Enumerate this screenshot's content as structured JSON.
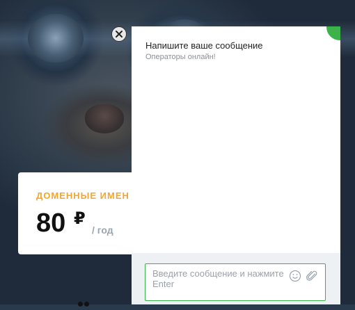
{
  "price_card": {
    "title": "ДОМЕННЫЕ ИМЕН",
    "amount": "80",
    "currency": "₽",
    "period": "/ год"
  },
  "chat": {
    "title": "Напишите ваше сообщение",
    "status": "Операторы онлайн!",
    "input_placeholder": "Введите сообщение и нажмите Enter",
    "accent_color": "#3cb34a"
  },
  "icons": {
    "close": "close-icon",
    "emoji": "smiley-icon",
    "attach": "paperclip-icon"
  }
}
